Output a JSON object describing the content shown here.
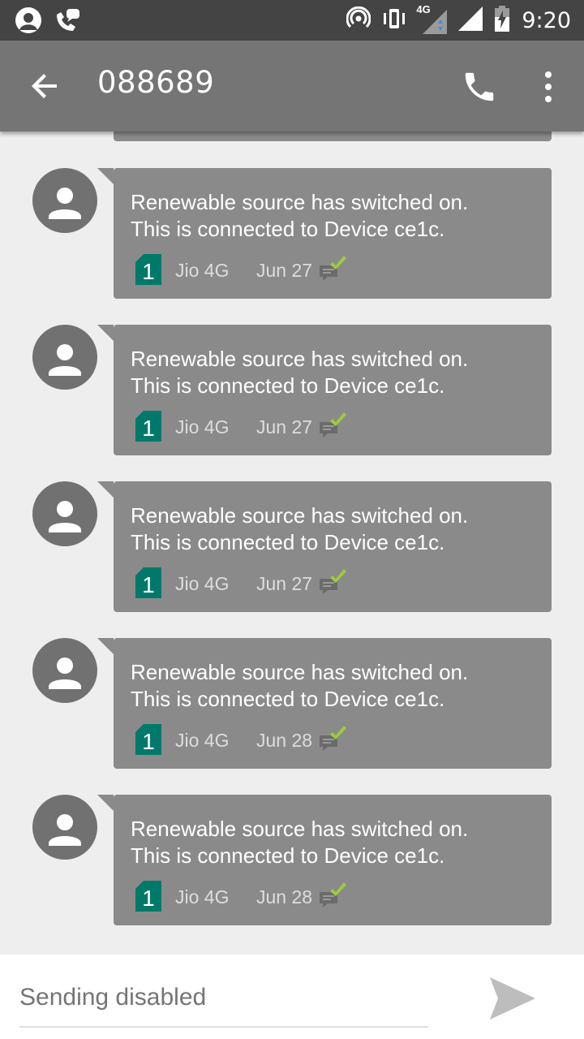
{
  "status_bar": {
    "time": "9:20",
    "network_label": "4G",
    "icons": [
      "avatar-status-icon",
      "wifi-call-icon",
      "hotspot-icon",
      "vibrate-icon",
      "signal-4g-icon",
      "signal-icon",
      "battery-charging-icon"
    ]
  },
  "app_bar": {
    "title": "088689",
    "back_icon": "arrow-back-icon",
    "call_icon": "phone-icon",
    "more_icon": "more-vert-icon"
  },
  "messages": [
    {
      "line1": "Renewable source has switched on.",
      "line2": "This is connected to Device ce1c.",
      "sim": "1",
      "carrier": "Jio 4G",
      "date": "Jun 27"
    },
    {
      "line1": "Renewable source has switched on.",
      "line2": "This is connected to Device ce1c.",
      "sim": "1",
      "carrier": "Jio 4G",
      "date": "Jun 27"
    },
    {
      "line1": "Renewable source has switched on.",
      "line2": "This is connected to Device ce1c.",
      "sim": "1",
      "carrier": "Jio 4G",
      "date": "Jun 27"
    },
    {
      "line1": "Renewable source has switched on.",
      "line2": "This is connected to Device ce1c.",
      "sim": "1",
      "carrier": "Jio 4G",
      "date": "Jun 28"
    },
    {
      "line1": "Renewable source has switched on.",
      "line2": "This is connected to Device ce1c.",
      "sim": "1",
      "carrier": "Jio 4G",
      "date": "Jun 28"
    }
  ],
  "compose": {
    "placeholder": "Sending disabled",
    "send_icon": "send-icon"
  },
  "colors": {
    "status_bar": "#444444",
    "app_bar": "#757575",
    "bubble": "#8a8a8a",
    "avatar": "#717171",
    "sim_badge": "#00796b",
    "delivered_check": "#9ccc3c",
    "background": "#eeeeee"
  }
}
